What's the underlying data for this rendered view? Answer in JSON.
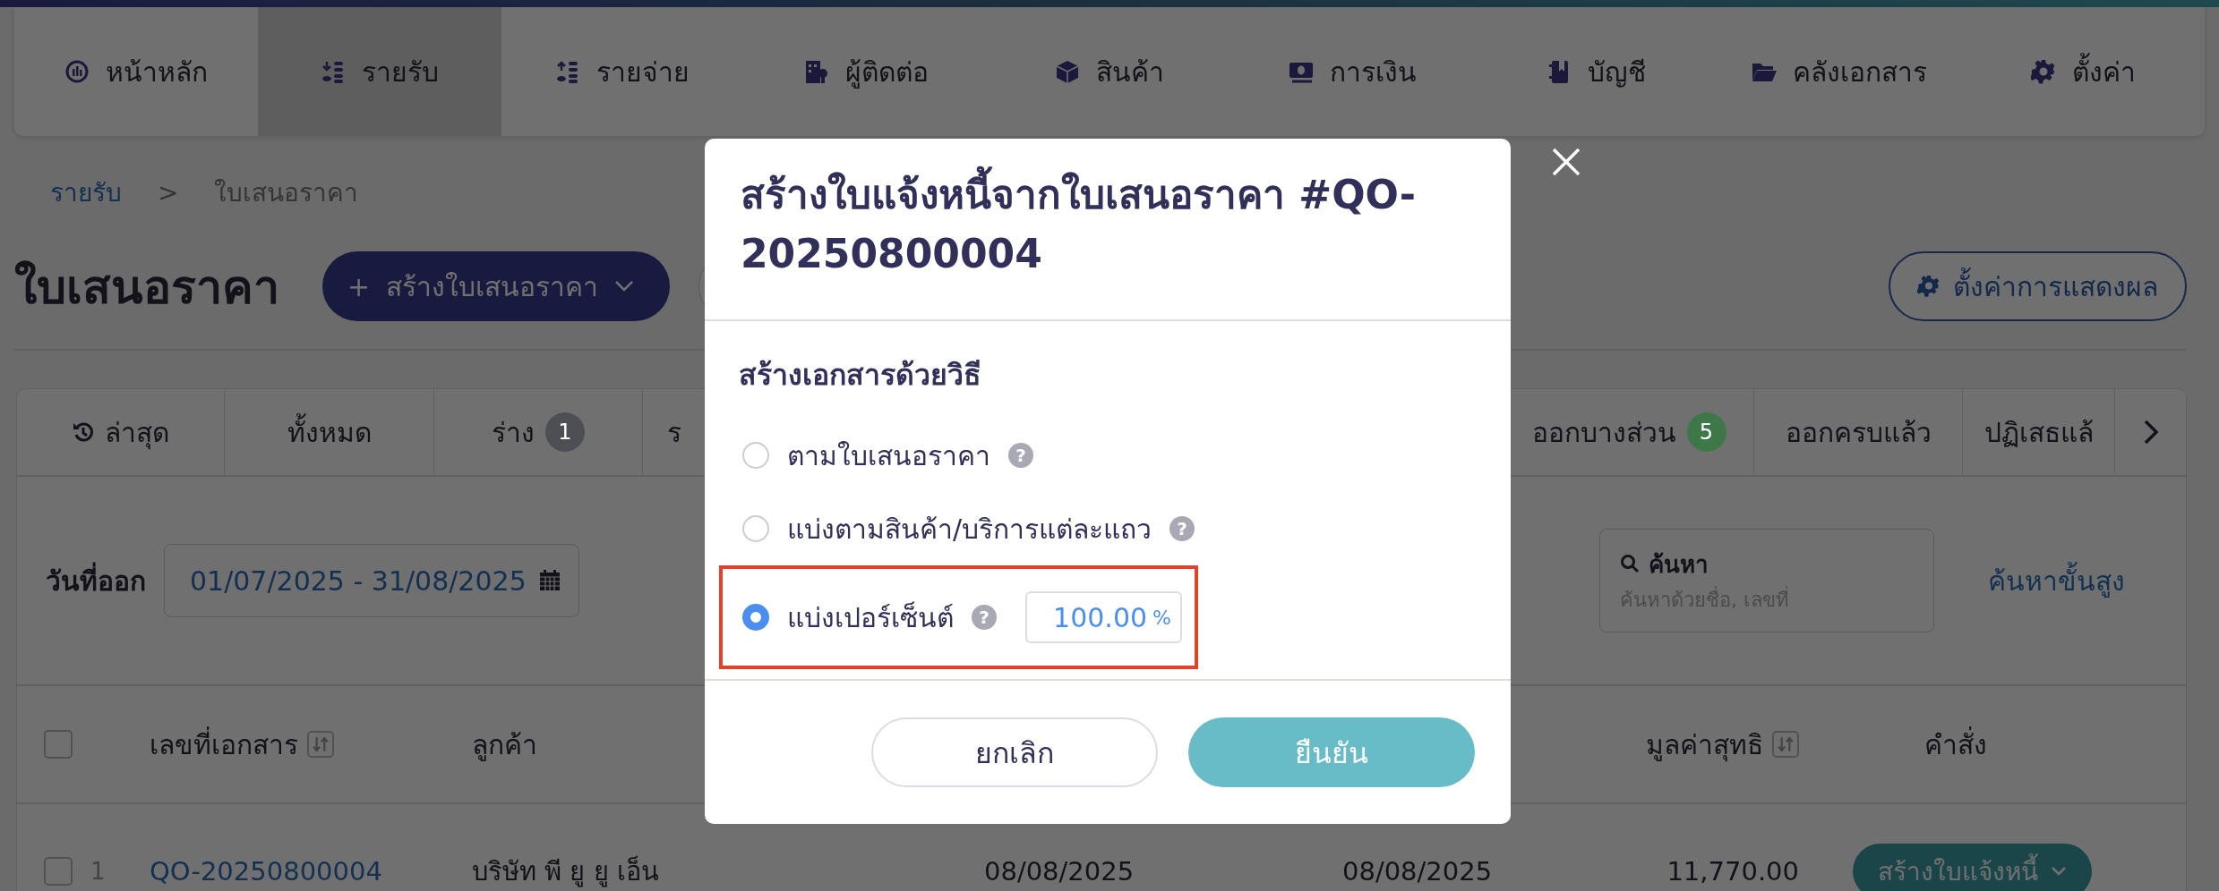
{
  "nav": [
    {
      "label": "หน้าหลัก",
      "selected": false
    },
    {
      "label": "รายรับ",
      "selected": true
    },
    {
      "label": "รายจ่าย",
      "selected": false
    },
    {
      "label": "ผู้ติดต่อ",
      "selected": false
    },
    {
      "label": "สินค้า",
      "selected": false
    },
    {
      "label": "การเงิน",
      "selected": false
    },
    {
      "label": "บัญชี",
      "selected": false
    },
    {
      "label": "คลังเอกสาร",
      "selected": false
    },
    {
      "label": "ตั้งค่า",
      "selected": false
    }
  ],
  "breadcrumb": {
    "parent": "รายรับ",
    "separator": ">",
    "current": "ใบเสนอราคา"
  },
  "page_title": "ใบเสนอราคา",
  "create_button": {
    "icon": "+",
    "label": "สร้างใบเสนอราคา"
  },
  "display_settings_button": "ตั้งค่าการแสดงผล",
  "status_tabs_left": [
    {
      "label": "ล่าสุด",
      "kind": "recent"
    },
    {
      "label": "ทั้งหมด",
      "kind": "plain"
    },
    {
      "label": "ร่าง",
      "kind": "count",
      "count": "1",
      "color": "#4d4f55"
    },
    {
      "label": "ร",
      "kind": "plain"
    }
  ],
  "status_tabs_right": [
    {
      "label": "ออกบางส่วน",
      "kind": "count",
      "count": "5",
      "color": "#3e7848"
    },
    {
      "label": "ออกครบแล้ว",
      "kind": "plain"
    },
    {
      "label": "ปฏิเสธแล้",
      "kind": "plain"
    }
  ],
  "filters": {
    "date_label": "วันที่ออก",
    "date_range": "01/07/2025 - 31/08/2025",
    "search_label": "ค้นหา",
    "search_placeholder": "ค้นหาด้วยชื่อ, เลขที่",
    "advanced_search": "ค้นหาขั้นสูง"
  },
  "table": {
    "select_all_checked": false,
    "columns": [
      {
        "label": "เลขที่เอกสาร",
        "sortable": true
      },
      {
        "label": "ลูกค้า",
        "sortable": false
      },
      {
        "label": "มูลค่าสุทธิ",
        "sortable": true
      },
      {
        "label": "คำสั่ง",
        "sortable": false
      }
    ],
    "rows": [
      {
        "index": "1",
        "checked": false,
        "number": "QO-20250800004",
        "customer": "บริษัท พี ยู ยู เอ็น",
        "issue_date": "08/08/2025",
        "due_date": "08/08/2025",
        "net_total": "11,770.00",
        "action": "สร้างใบแจ้งหนี้"
      }
    ]
  },
  "dialog": {
    "title": "สร้างใบแจ้งหนี้จากใบเสนอราคา #QO-20250800004",
    "section_label": "สร้างเอกสารด้วยวิธี",
    "options": [
      {
        "label": "ตามใบเสนอราคา",
        "help": "?",
        "selected": false,
        "highlighted": false
      },
      {
        "label": "แบ่งตามสินค้า/บริการแต่ละแถว",
        "help": "?",
        "selected": false,
        "highlighted": false
      },
      {
        "label": "แบ่งเปอร์เซ็นต์",
        "help": "?",
        "selected": true,
        "highlighted": true,
        "input_value": "100.00",
        "input_unit": "%"
      }
    ],
    "buttons": [
      {
        "label": "ยกเลิก",
        "kind": "secondary"
      },
      {
        "label": "ยืนยัน",
        "kind": "primary"
      }
    ]
  }
}
